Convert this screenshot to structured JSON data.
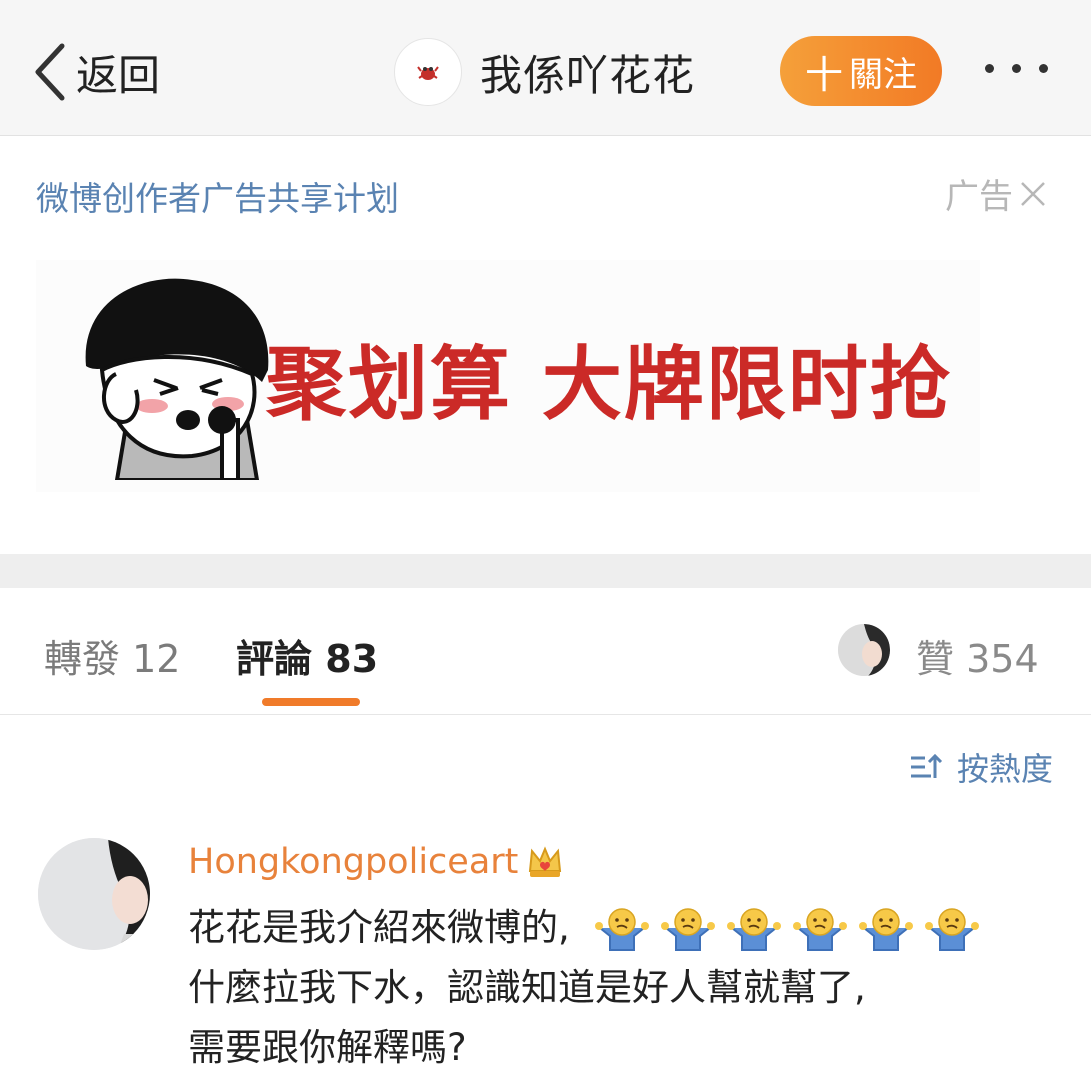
{
  "header": {
    "back_label": "返回",
    "nickname": "我係吖花花",
    "follow_label": "關注",
    "follow_plus": "十"
  },
  "ad": {
    "label": "微博创作者广告共享计划",
    "tag": "广告",
    "banner_text": "聚划算 大牌限时抢"
  },
  "tabs": {
    "repost_label": "轉發",
    "repost_count": "12",
    "comment_label": "評論",
    "comment_count": "83",
    "like_label": "贊",
    "like_count": "354"
  },
  "sort": {
    "label": "按熱度"
  },
  "comment": {
    "username": "Hongkongpoliceart",
    "line1": "花花是我介紹來微博的,",
    "line2": "什麼拉我下水，認識知道是好人幫就幫了,",
    "line3": "需要跟你解釋嗎?",
    "emoji_count": 6
  },
  "colors": {
    "accent_orange": "#f07b2a",
    "link_blue": "#5a83b2",
    "banner_red": "#cb2a27",
    "username_orange": "#e8823b"
  },
  "icons": [
    "back-chevron-icon",
    "crab-avatar-icon",
    "more-dots-icon",
    "close-icon",
    "sort-icon",
    "crown-icon",
    "shrug-emoji-icon"
  ]
}
